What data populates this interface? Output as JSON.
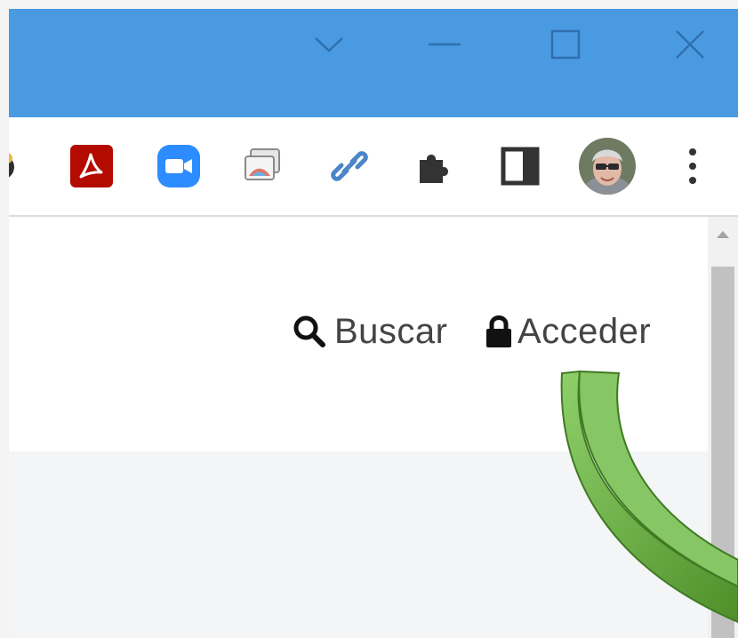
{
  "titlebar": {
    "background": "#4a9ae1",
    "controls": [
      {
        "name": "tab-search",
        "icon": "chevron-down-icon"
      },
      {
        "name": "minimize",
        "icon": "minimize-icon"
      },
      {
        "name": "maximize",
        "icon": "maximize-icon"
      },
      {
        "name": "close",
        "icon": "close-icon"
      }
    ]
  },
  "toolbar": {
    "extensions": [
      {
        "icon": "planet-extension-icon"
      },
      {
        "icon": "acrobat-pdf-icon",
        "color": "#b30b00"
      },
      {
        "icon": "zoom-video-icon",
        "color": "#2d8cff"
      },
      {
        "icon": "screenshot-gallery-icon"
      },
      {
        "icon": "link-icon",
        "color": "#4a86c8"
      },
      {
        "icon": "puzzle-extensions-icon"
      },
      {
        "icon": "side-panel-icon"
      },
      {
        "icon": "profile-avatar"
      },
      {
        "icon": "kebab-menu-icon"
      }
    ]
  },
  "header": {
    "search_label": "Buscar",
    "login_label": "Acceder",
    "search_icon": "search-icon",
    "login_icon": "lock-icon"
  },
  "annotation": {
    "color": "#5ea83a",
    "icon": "curved-arrow-annotation"
  }
}
